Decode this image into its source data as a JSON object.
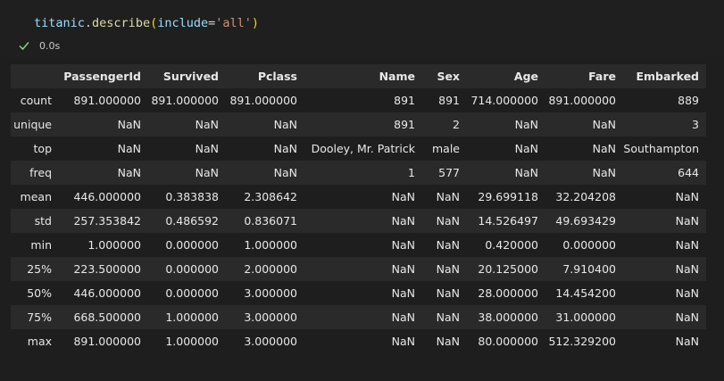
{
  "code": {
    "var": "titanic",
    "dot": ".",
    "func": "describe",
    "open": "(",
    "param": "include",
    "eq": "=",
    "value": "'all'",
    "close": ")"
  },
  "status": {
    "icon": "check-icon",
    "duration": "0.0s",
    "color": "#89d185"
  },
  "table": {
    "columns": [
      "",
      "PassengerId",
      "Survived",
      "Pclass",
      "Name",
      "Sex",
      "Age",
      "Fare",
      "Embarked"
    ],
    "rows": [
      [
        "count",
        "891.000000",
        "891.000000",
        "891.000000",
        "891",
        "891",
        "714.000000",
        "891.000000",
        "889"
      ],
      [
        "unique",
        "NaN",
        "NaN",
        "NaN",
        "891",
        "2",
        "NaN",
        "NaN",
        "3"
      ],
      [
        "top",
        "NaN",
        "NaN",
        "NaN",
        "Dooley, Mr. Patrick",
        "male",
        "NaN",
        "NaN",
        "Southampton"
      ],
      [
        "freq",
        "NaN",
        "NaN",
        "NaN",
        "1",
        "577",
        "NaN",
        "NaN",
        "644"
      ],
      [
        "mean",
        "446.000000",
        "0.383838",
        "2.308642",
        "NaN",
        "NaN",
        "29.699118",
        "32.204208",
        "NaN"
      ],
      [
        "std",
        "257.353842",
        "0.486592",
        "0.836071",
        "NaN",
        "NaN",
        "14.526497",
        "49.693429",
        "NaN"
      ],
      [
        "min",
        "1.000000",
        "0.000000",
        "1.000000",
        "NaN",
        "NaN",
        "0.420000",
        "0.000000",
        "NaN"
      ],
      [
        "25%",
        "223.500000",
        "0.000000",
        "2.000000",
        "NaN",
        "NaN",
        "20.125000",
        "7.910400",
        "NaN"
      ],
      [
        "50%",
        "446.000000",
        "0.000000",
        "3.000000",
        "NaN",
        "NaN",
        "28.000000",
        "14.454200",
        "NaN"
      ],
      [
        "75%",
        "668.500000",
        "1.000000",
        "3.000000",
        "NaN",
        "NaN",
        "38.000000",
        "31.000000",
        "NaN"
      ],
      [
        "max",
        "891.000000",
        "1.000000",
        "3.000000",
        "NaN",
        "NaN",
        "80.000000",
        "512.329200",
        "NaN"
      ]
    ]
  }
}
